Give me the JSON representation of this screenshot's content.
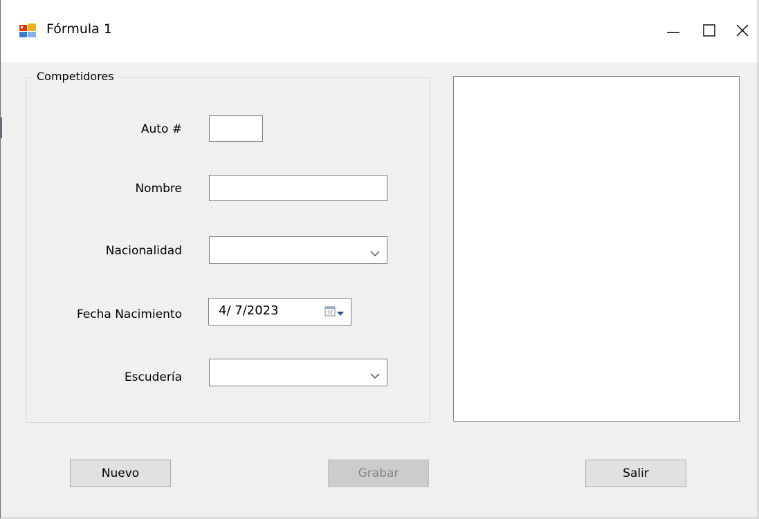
{
  "window": {
    "title": "Fórmula 1",
    "controls": {
      "minimize_icon": "minimize-icon",
      "maximize_icon": "maximize-icon",
      "close_icon": "close-icon"
    }
  },
  "group": {
    "title": "Competidores"
  },
  "form": {
    "auto_label": "Auto #",
    "auto_value": "",
    "nombre_label": "Nombre",
    "nombre_value": "",
    "nacionalidad_label": "Nacionalidad",
    "nacionalidad_value": "",
    "fecha_label": "Fecha Nacimiento",
    "fecha_value": "4/ 7/2023",
    "escuderia_label": "Escudería",
    "escuderia_value": ""
  },
  "buttons": {
    "nuevo": "Nuevo",
    "grabar": "Grabar",
    "salir": "Salir"
  },
  "colors": {
    "window_bg": "#f0f0f0",
    "titlebar_bg": "#ffffff",
    "disabled_text": "#838383"
  }
}
